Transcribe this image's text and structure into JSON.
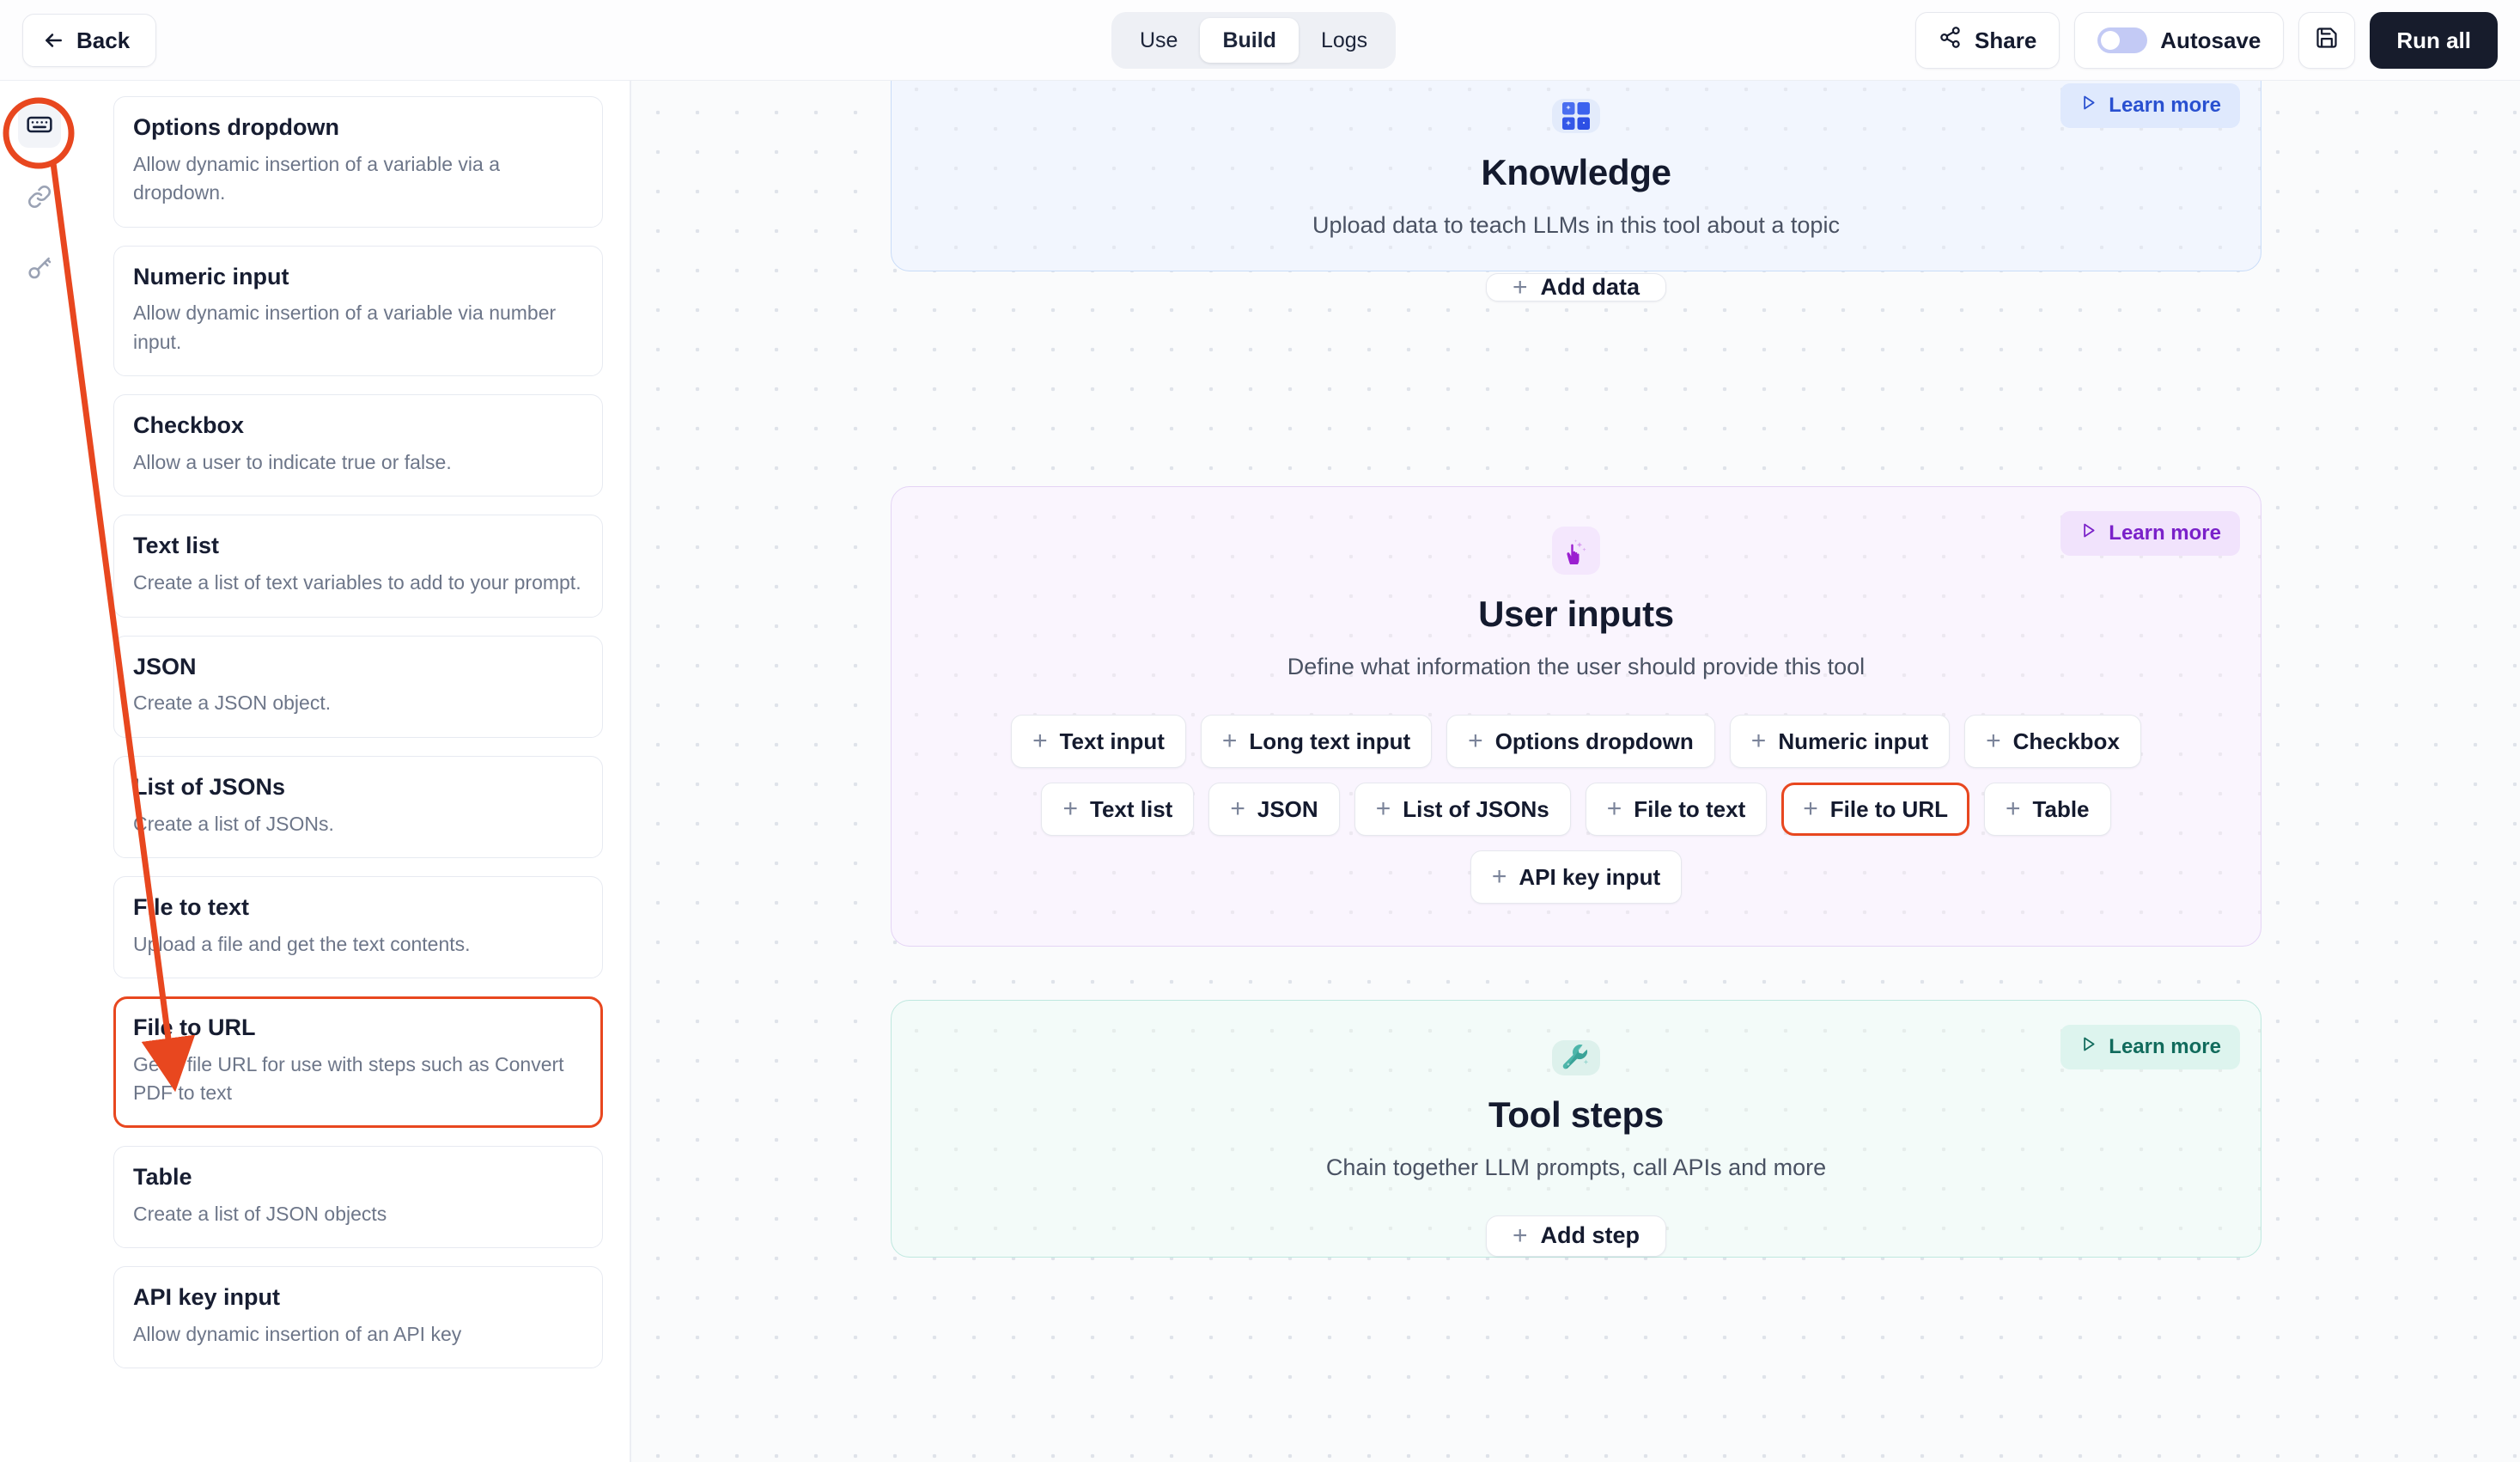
{
  "topbar": {
    "back_label": "Back",
    "tabs": [
      {
        "label": "Use",
        "active": false
      },
      {
        "label": "Build",
        "active": true
      },
      {
        "label": "Logs",
        "active": false
      }
    ],
    "share_label": "Share",
    "autosave_label": "Autosave",
    "autosave_on": false,
    "save_icon": "floppy-disk-icon",
    "run_all_label": "Run all"
  },
  "rail": {
    "items": [
      {
        "icon": "keyboard-input-icon",
        "selected": true
      },
      {
        "icon": "link-chain-icon",
        "selected": false
      },
      {
        "icon": "key-icon",
        "selected": false
      }
    ]
  },
  "panel": {
    "cards": [
      {
        "title": "Options dropdown",
        "desc": "Allow dynamic insertion of a variable via a dropdown.",
        "highlighted": false
      },
      {
        "title": "Numeric input",
        "desc": "Allow dynamic insertion of a variable via number input.",
        "highlighted": false
      },
      {
        "title": "Checkbox",
        "desc": "Allow a user to indicate true or false.",
        "highlighted": false
      },
      {
        "title": "Text list",
        "desc": "Create a list of text variables to add to your prompt.",
        "highlighted": false
      },
      {
        "title": "JSON",
        "desc": "Create a JSON object.",
        "highlighted": false
      },
      {
        "title": "List of JSONs",
        "desc": "Create a list of JSONs.",
        "highlighted": false
      },
      {
        "title": "File to text",
        "desc": "Upload a file and get the text contents.",
        "highlighted": false
      },
      {
        "title": "File to URL",
        "desc": "Get a file URL for use with steps such as Convert PDF to text",
        "highlighted": true
      },
      {
        "title": "Table",
        "desc": "Create a list of JSON objects",
        "highlighted": false
      },
      {
        "title": "API key input",
        "desc": "Allow dynamic insertion of an API key",
        "highlighted": false
      }
    ]
  },
  "canvas": {
    "blocks": [
      {
        "id": "knowledge",
        "icon": "knowledge-grid-icon",
        "title": "Knowledge",
        "subtitle": "Upload data to teach LLMs in this tool about a topic",
        "learn_more": "Learn more",
        "action_label": "Add data",
        "accent": "#2950d0"
      },
      {
        "id": "user-inputs",
        "icon": "magic-hand-icon",
        "title": "User inputs",
        "subtitle": "Define what information the user should provide this tool",
        "learn_more": "Learn more",
        "accent": "#7a21c9",
        "chips": [
          {
            "label": "Text input",
            "highlighted": false
          },
          {
            "label": "Long text input",
            "highlighted": false
          },
          {
            "label": "Options dropdown",
            "highlighted": false
          },
          {
            "label": "Numeric input",
            "highlighted": false
          },
          {
            "label": "Checkbox",
            "highlighted": false
          },
          {
            "label": "Text list",
            "highlighted": false
          },
          {
            "label": "JSON",
            "highlighted": false
          },
          {
            "label": "List of JSONs",
            "highlighted": false
          },
          {
            "label": "File to text",
            "highlighted": false
          },
          {
            "label": "File to URL",
            "highlighted": true
          },
          {
            "label": "Table",
            "highlighted": false
          },
          {
            "label": "API key input",
            "highlighted": false
          }
        ]
      },
      {
        "id": "tool-steps",
        "icon": "wrench-icon",
        "title": "Tool steps",
        "subtitle": "Chain together LLM prompts, call APIs and more",
        "learn_more": "Learn more",
        "action_label": "Add step",
        "accent": "#116b5c"
      }
    ]
  },
  "annotation": {
    "color": "#e8471f",
    "shapes": [
      "circle-around-rail-icon",
      "arrow-to-file-to-url-card",
      "box-around-file-to-url-card",
      "box-around-file-to-url-chip"
    ]
  }
}
